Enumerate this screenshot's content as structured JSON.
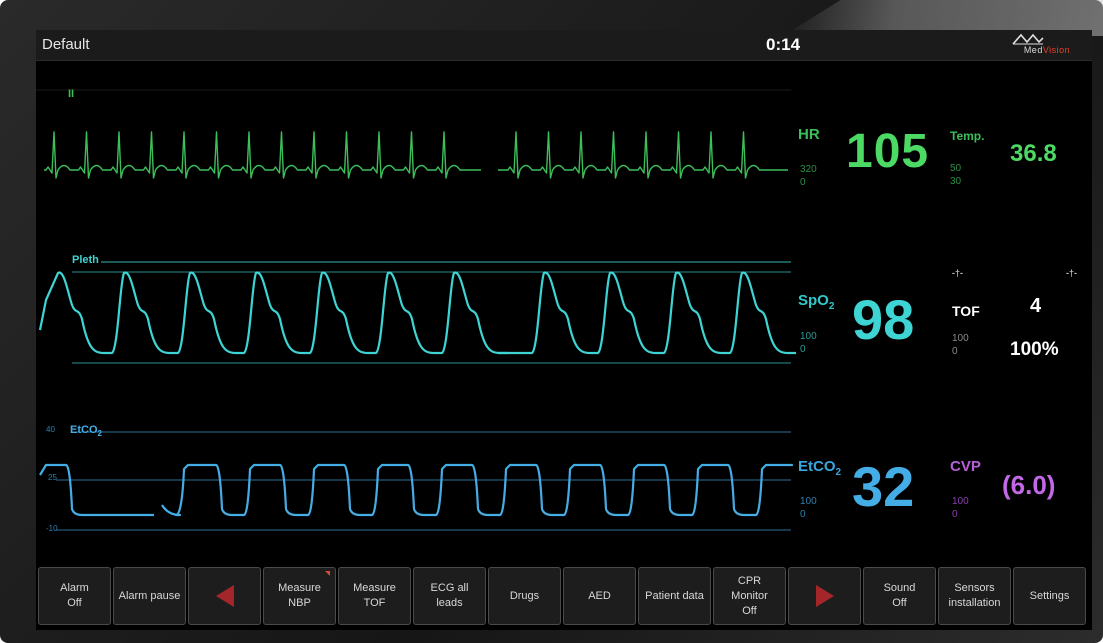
{
  "header": {
    "profile": "Default",
    "timer": "0:14",
    "logo_text_a": "Med",
    "logo_text_b": "Vision"
  },
  "ecg": {
    "lead_label": "II",
    "param_label": "HR",
    "value": "105",
    "alarm_high": "320",
    "alarm_low": "0"
  },
  "temp": {
    "label": "Temp.",
    "value": "36.8",
    "alarm_high": "50",
    "alarm_low": "30"
  },
  "pleth": {
    "wave_label": "Pleth",
    "param_label": "SpO",
    "param_sub": "2",
    "value": "98",
    "alarm_high": "100",
    "alarm_low": "0"
  },
  "tof": {
    "label": "TOF",
    "count": "4",
    "ratio": "100%",
    "alarm_high": "100",
    "alarm_low": "0"
  },
  "etco2": {
    "wave_label": "EtCO",
    "wave_sub": "2",
    "scale_top": "40",
    "scale_mid": "25",
    "scale_bottom": "-10",
    "param_label": "EtCO",
    "param_sub": "2",
    "value": "32",
    "alarm_high": "100",
    "alarm_low": "0"
  },
  "cvp": {
    "label": "CVP",
    "value": "(6.0)",
    "alarm_high": "100",
    "alarm_low": "0"
  },
  "toolbar": {
    "alarm_off": "Alarm\nOff",
    "alarm_pause": "Alarm pause",
    "measure_nbp": "Measure\nNBP",
    "measure_tof": "Measure\nTOF",
    "ecg_all_leads": "ECG all\nleads",
    "drugs": "Drugs",
    "aed": "AED",
    "patient_data": "Patient data",
    "cpr_monitor": "CPR\nMonitor\nOff",
    "sound_off": "Sound\nOff",
    "sensors_installation": "Sensors\ninstallation",
    "settings": "Settings"
  },
  "icons": [
    "left-arrow-icon",
    "right-arrow-icon",
    "medvision-logo-icon",
    "alert-flag-icon",
    "pin-icon"
  ],
  "colors": {
    "ecg": "#3cbf5a",
    "pleth": "#3fd4d4",
    "etco2": "#45ade6",
    "cvp": "#c267e6",
    "arrow": "#a5262a"
  }
}
